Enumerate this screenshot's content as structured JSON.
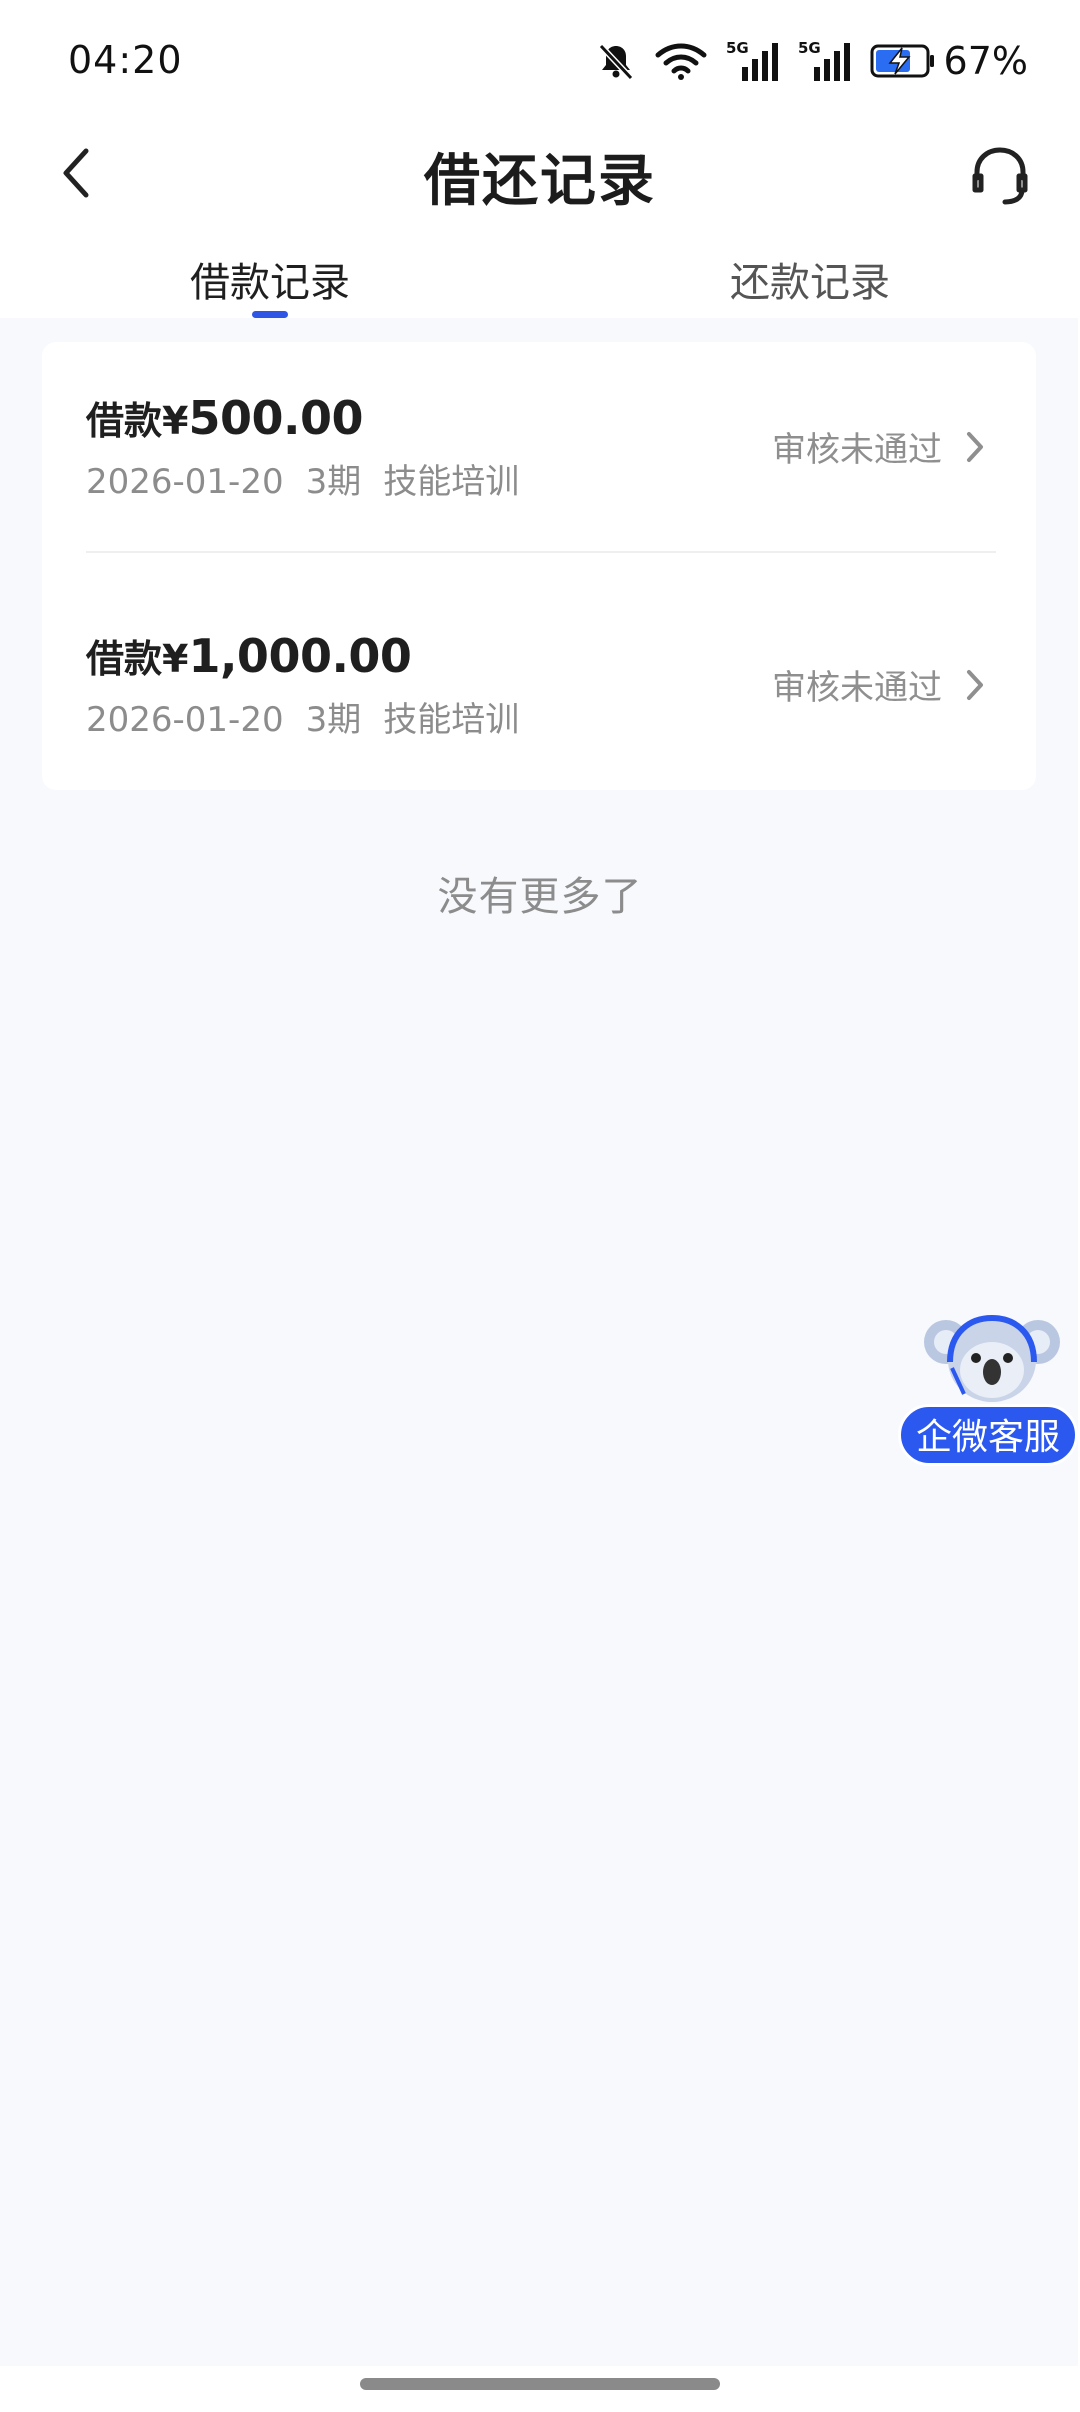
{
  "status_bar": {
    "time": "04:20",
    "battery_percent": "67%",
    "icons": [
      "mute-bell-icon",
      "wifi-icon",
      "signal-5g-icon",
      "signal-5g-icon",
      "battery-charging-icon"
    ]
  },
  "nav": {
    "title": "借还记录",
    "back_icon": "chevron-left-icon",
    "service_icon": "headset-icon"
  },
  "tabs": [
    {
      "label": "借款记录",
      "active": true
    },
    {
      "label": "还款记录",
      "active": false
    }
  ],
  "records": [
    {
      "prefix": "借款¥",
      "amount": "500.00",
      "date": "2026-01-20",
      "periods": "3期",
      "purpose": "技能培训",
      "status": "审核未通过"
    },
    {
      "prefix": "借款¥",
      "amount": "1,000.00",
      "date": "2026-01-20",
      "periods": "3期",
      "purpose": "技能培训",
      "status": "审核未通过"
    }
  ],
  "list_end_text": "没有更多了",
  "float_service": {
    "label": "企微客服"
  },
  "colors": {
    "accent": "#2f55e4",
    "float_button": "#2b59f0",
    "page_bg": "#f7f9fd",
    "muted_text": "#8c8c8c"
  }
}
